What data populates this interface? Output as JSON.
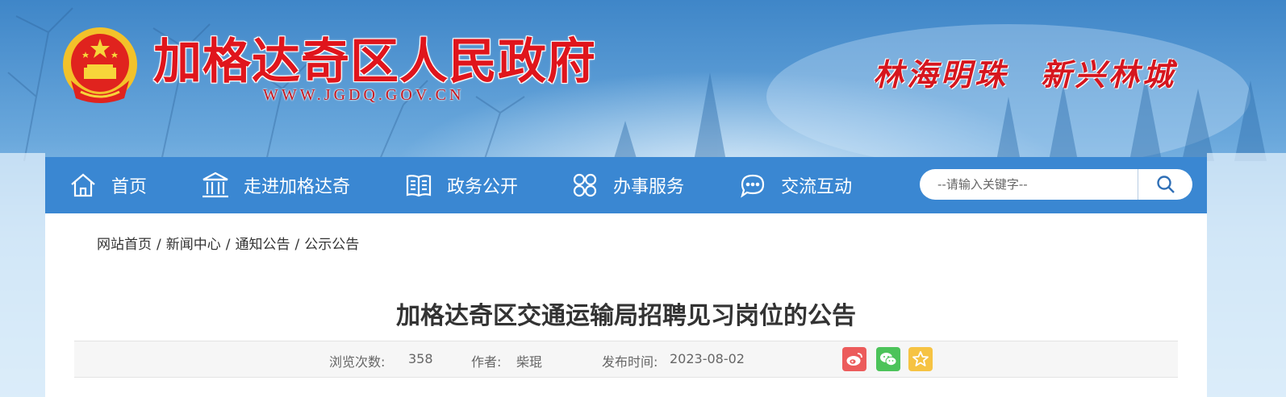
{
  "header": {
    "site_name": "加格达奇区人民政府",
    "site_url": "WWW.JGDQ.GOV.CN",
    "slogan": [
      "林海明珠",
      "新兴林城"
    ]
  },
  "nav": {
    "items": [
      {
        "label": "首页",
        "icon": "home-icon"
      },
      {
        "label": "走进加格达奇",
        "icon": "building-icon"
      },
      {
        "label": "政务公开",
        "icon": "book-icon"
      },
      {
        "label": "办事服务",
        "icon": "grid-icon"
      },
      {
        "label": "交流互动",
        "icon": "chat-icon"
      }
    ]
  },
  "search": {
    "placeholder": "--请输入关键字--",
    "icon": "search-icon"
  },
  "breadcrumb": [
    "网站首页",
    "新闻中心",
    "通知公告",
    "公示公告"
  ],
  "article": {
    "title": "加格达奇区交通运输局招聘见习岗位的公告",
    "views_label": "浏览次数:",
    "views": "358",
    "author_label": "作者:",
    "author": "柴琨",
    "date_label": "发布时间:",
    "date": "2023-08-02"
  },
  "share": [
    {
      "icon": "weibo-icon",
      "color": "#ec5b5b"
    },
    {
      "icon": "wechat-icon",
      "color": "#4cc35a"
    },
    {
      "icon": "favorite-icon",
      "color": "#f6c343"
    }
  ],
  "colors": {
    "brand_red": "#e0151c",
    "nav_blue": "#3a87d2"
  }
}
